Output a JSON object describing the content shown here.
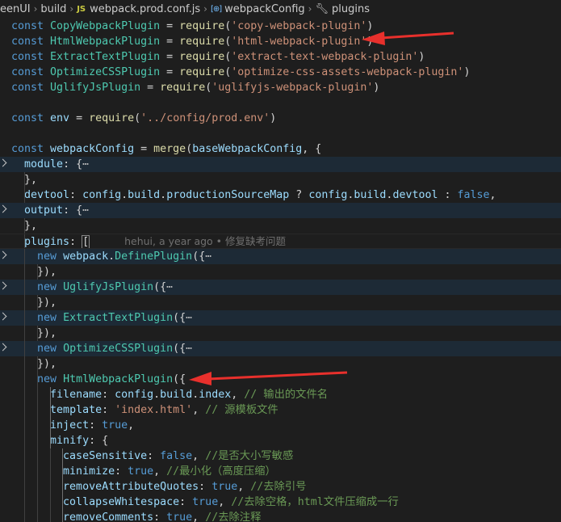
{
  "breadcrumb": {
    "items": [
      "eenUI",
      "build",
      "webpack.prod.conf.js",
      "webpackConfig",
      "plugins"
    ],
    "file_icon": "JS",
    "symbol_icon": "[⊕]",
    "separator": "›"
  },
  "editor": {
    "blame": "hehui, a year ago • 修复缺考问题",
    "colors": {
      "background": "#1e1e1e",
      "keyword": "#569cd6",
      "class": "#4ec9b0",
      "string": "#ce9178",
      "comment": "#6a9955",
      "annotation_arrow": "#e8302c"
    },
    "lines": [
      {
        "fold": false,
        "g": 0,
        "t": [
          [
            "kw",
            "const "
          ],
          [
            "cls",
            "CopyWebpackPlugin"
          ],
          [
            "pun",
            " = "
          ],
          [
            "fn",
            "require"
          ],
          [
            "pun",
            "("
          ],
          [
            "str",
            "'copy-webpack-plugin'"
          ],
          [
            "pun",
            ")"
          ]
        ]
      },
      {
        "fold": false,
        "g": 0,
        "t": [
          [
            "kw",
            "const "
          ],
          [
            "cls",
            "HtmlWebpackPlugin"
          ],
          [
            "pun",
            " = "
          ],
          [
            "fn",
            "require"
          ],
          [
            "pun",
            "("
          ],
          [
            "str",
            "'html-webpack-plugin'"
          ],
          [
            "pun",
            ")"
          ]
        ]
      },
      {
        "fold": false,
        "g": 0,
        "t": [
          [
            "kw",
            "const "
          ],
          [
            "cls",
            "ExtractTextPlugin"
          ],
          [
            "pun",
            " = "
          ],
          [
            "fn",
            "require"
          ],
          [
            "pun",
            "("
          ],
          [
            "str",
            "'extract-text-webpack-plugin'"
          ],
          [
            "pun",
            ")"
          ]
        ]
      },
      {
        "fold": false,
        "g": 0,
        "t": [
          [
            "kw",
            "const "
          ],
          [
            "cls",
            "OptimizeCSSPlugin"
          ],
          [
            "pun",
            " = "
          ],
          [
            "fn",
            "require"
          ],
          [
            "pun",
            "("
          ],
          [
            "str",
            "'optimize-css-assets-webpack-plugin'"
          ],
          [
            "pun",
            ")"
          ]
        ]
      },
      {
        "fold": false,
        "g": 0,
        "t": [
          [
            "kw",
            "const "
          ],
          [
            "cls",
            "UglifyJsPlugin"
          ],
          [
            "pun",
            " = "
          ],
          [
            "fn",
            "require"
          ],
          [
            "pun",
            "("
          ],
          [
            "str",
            "'uglifyjs-webpack-plugin'"
          ],
          [
            "pun",
            ")"
          ]
        ]
      },
      {
        "fold": false,
        "g": 0,
        "t": []
      },
      {
        "fold": false,
        "g": 0,
        "t": [
          [
            "kw",
            "const "
          ],
          [
            "var",
            "env"
          ],
          [
            "pun",
            " = "
          ],
          [
            "fn",
            "require"
          ],
          [
            "pun",
            "("
          ],
          [
            "str",
            "'../config/prod.env'"
          ],
          [
            "pun",
            ")"
          ]
        ]
      },
      {
        "fold": false,
        "g": 0,
        "t": []
      },
      {
        "fold": false,
        "g": 0,
        "t": [
          [
            "kw",
            "const "
          ],
          [
            "var",
            "webpackConfig"
          ],
          [
            "pun",
            " = "
          ],
          [
            "fn",
            "merge"
          ],
          [
            "pun",
            "("
          ],
          [
            "var",
            "baseWebpackConfig"
          ],
          [
            "pun",
            ", {"
          ]
        ]
      },
      {
        "fold": true,
        "g": 0,
        "t": [
          [
            "pun",
            "  "
          ],
          [
            "var",
            "module"
          ],
          [
            "pun",
            ": {"
          ],
          [
            "ell",
            "⋯"
          ]
        ]
      },
      {
        "fold": false,
        "g": 1,
        "t": [
          [
            "pun",
            "  },"
          ]
        ]
      },
      {
        "fold": false,
        "g": 1,
        "t": [
          [
            "pun",
            "  "
          ],
          [
            "var",
            "devtool"
          ],
          [
            "pun",
            ": "
          ],
          [
            "var",
            "config"
          ],
          [
            "pun",
            "."
          ],
          [
            "var",
            "build"
          ],
          [
            "pun",
            "."
          ],
          [
            "var",
            "productionSourceMap"
          ],
          [
            "pun",
            " ? "
          ],
          [
            "var",
            "config"
          ],
          [
            "pun",
            "."
          ],
          [
            "var",
            "build"
          ],
          [
            "pun",
            "."
          ],
          [
            "var",
            "devtool"
          ],
          [
            "pun",
            " : "
          ],
          [
            "kw",
            "false"
          ],
          [
            "pun",
            ","
          ]
        ]
      },
      {
        "fold": true,
        "g": 0,
        "t": [
          [
            "pun",
            "  "
          ],
          [
            "var",
            "output"
          ],
          [
            "pun",
            ": {"
          ],
          [
            "ell",
            "⋯"
          ]
        ]
      },
      {
        "fold": false,
        "g": 1,
        "t": [
          [
            "pun",
            "  },"
          ]
        ]
      },
      {
        "fold": false,
        "g": 1,
        "active": true,
        "blame": true,
        "t": [
          [
            "pun",
            "  "
          ],
          [
            "var",
            "plugins"
          ],
          [
            "pun",
            ": "
          ],
          [
            "box",
            "["
          ]
        ]
      },
      {
        "fold": true,
        "g": 1,
        "t": [
          [
            "pun",
            "    "
          ],
          [
            "kw",
            "new "
          ],
          [
            "var",
            "webpack"
          ],
          [
            "pun",
            "."
          ],
          [
            "cls",
            "DefinePlugin"
          ],
          [
            "pun",
            "({"
          ],
          [
            "ell",
            "⋯"
          ]
        ]
      },
      {
        "fold": false,
        "g": 2,
        "t": [
          [
            "pun",
            "    }),"
          ]
        ]
      },
      {
        "fold": true,
        "g": 1,
        "t": [
          [
            "pun",
            "    "
          ],
          [
            "kw",
            "new "
          ],
          [
            "cls",
            "UglifyJsPlugin"
          ],
          [
            "pun",
            "({"
          ],
          [
            "ell",
            "⋯"
          ]
        ]
      },
      {
        "fold": false,
        "g": 2,
        "t": [
          [
            "pun",
            "    }),"
          ]
        ]
      },
      {
        "fold": true,
        "g": 1,
        "t": [
          [
            "pun",
            "    "
          ],
          [
            "kw",
            "new "
          ],
          [
            "cls",
            "ExtractTextPlugin"
          ],
          [
            "pun",
            "({"
          ],
          [
            "ell",
            "⋯"
          ]
        ]
      },
      {
        "fold": false,
        "g": 2,
        "t": [
          [
            "pun",
            "    }),"
          ]
        ]
      },
      {
        "fold": true,
        "g": 1,
        "t": [
          [
            "pun",
            "    "
          ],
          [
            "kw",
            "new "
          ],
          [
            "cls",
            "OptimizeCSSPlugin"
          ],
          [
            "pun",
            "({"
          ],
          [
            "ell",
            "⋯"
          ]
        ]
      },
      {
        "fold": false,
        "g": 2,
        "t": [
          [
            "pun",
            "    }),"
          ]
        ]
      },
      {
        "fold": false,
        "g": 2,
        "t": [
          [
            "pun",
            "    "
          ],
          [
            "kw",
            "new "
          ],
          [
            "cls",
            "HtmlWebpackPlugin"
          ],
          [
            "pun",
            "({"
          ]
        ]
      },
      {
        "fold": false,
        "g": 3,
        "t": [
          [
            "pun",
            "      "
          ],
          [
            "var",
            "filename"
          ],
          [
            "pun",
            ": "
          ],
          [
            "var",
            "config"
          ],
          [
            "pun",
            "."
          ],
          [
            "var",
            "build"
          ],
          [
            "pun",
            "."
          ],
          [
            "var",
            "index"
          ],
          [
            "pun",
            ", "
          ],
          [
            "cmt",
            "// 输出的文件名"
          ]
        ]
      },
      {
        "fold": false,
        "g": 3,
        "t": [
          [
            "pun",
            "      "
          ],
          [
            "var",
            "template"
          ],
          [
            "pun",
            ": "
          ],
          [
            "str",
            "'index.html'"
          ],
          [
            "pun",
            ", "
          ],
          [
            "cmt",
            "// 源模板文件"
          ]
        ]
      },
      {
        "fold": false,
        "g": 3,
        "t": [
          [
            "pun",
            "      "
          ],
          [
            "var",
            "inject"
          ],
          [
            "pun",
            ": "
          ],
          [
            "kw",
            "true"
          ],
          [
            "pun",
            ","
          ]
        ]
      },
      {
        "fold": false,
        "g": 3,
        "t": [
          [
            "pun",
            "      "
          ],
          [
            "var",
            "minify"
          ],
          [
            "pun",
            ": {"
          ]
        ]
      },
      {
        "fold": false,
        "g": 4,
        "t": [
          [
            "pun",
            "        "
          ],
          [
            "var",
            "caseSensitive"
          ],
          [
            "pun",
            ": "
          ],
          [
            "kw",
            "false"
          ],
          [
            "pun",
            ", "
          ],
          [
            "cmt",
            "//是否大小写敏感"
          ]
        ]
      },
      {
        "fold": false,
        "g": 4,
        "t": [
          [
            "pun",
            "        "
          ],
          [
            "var",
            "minimize"
          ],
          [
            "pun",
            ": "
          ],
          [
            "kw",
            "true"
          ],
          [
            "pun",
            ", "
          ],
          [
            "cmt",
            "//最小化（高度压缩）"
          ]
        ]
      },
      {
        "fold": false,
        "g": 4,
        "t": [
          [
            "pun",
            "        "
          ],
          [
            "var",
            "removeAttributeQuotes"
          ],
          [
            "pun",
            ": "
          ],
          [
            "kw",
            "true"
          ],
          [
            "pun",
            ", "
          ],
          [
            "cmt",
            "//去除引号"
          ]
        ]
      },
      {
        "fold": false,
        "g": 4,
        "t": [
          [
            "pun",
            "        "
          ],
          [
            "var",
            "collapseWhitespace"
          ],
          [
            "pun",
            ": "
          ],
          [
            "kw",
            "true"
          ],
          [
            "pun",
            ", "
          ],
          [
            "cmt",
            "//去除空格，html文件压缩成一行"
          ]
        ]
      },
      {
        "fold": false,
        "g": 4,
        "t": [
          [
            "pun",
            "        "
          ],
          [
            "var",
            "removeComments"
          ],
          [
            "pun",
            ": "
          ],
          [
            "kw",
            "true"
          ],
          [
            "pun",
            ", "
          ],
          [
            "cmt",
            "//去除注释"
          ]
        ]
      }
    ]
  }
}
